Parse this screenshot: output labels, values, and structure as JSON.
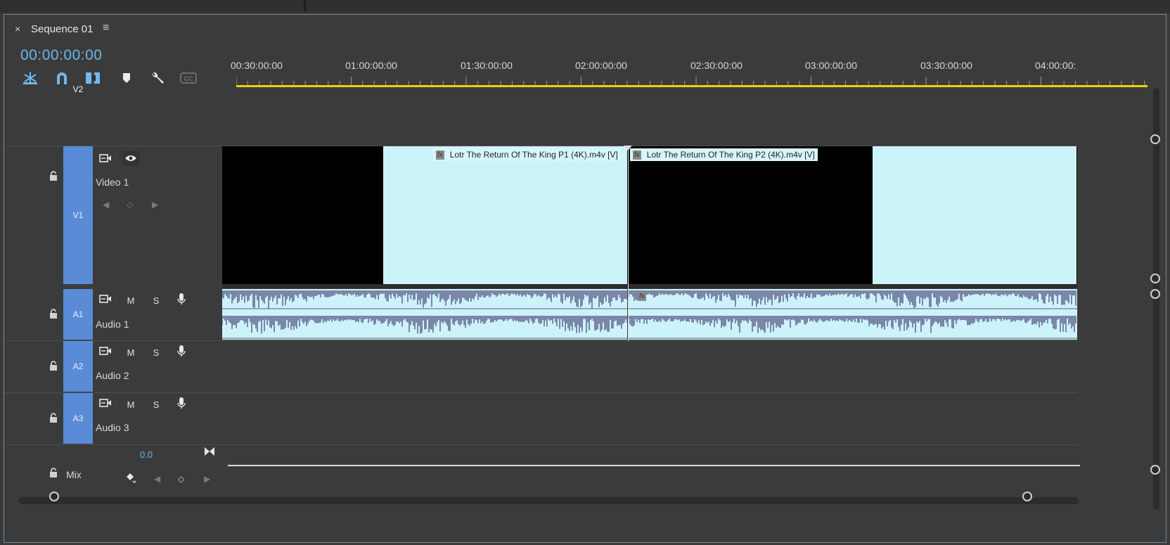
{
  "panel": {
    "title": "Sequence 01",
    "close_glyph": "×",
    "menu_glyph": "≡",
    "timecode": "00:00:00:00"
  },
  "toolbar": [
    {
      "name": "insert-overwrite-icon",
      "glyph": "✲",
      "color": "#6fb7ef"
    },
    {
      "name": "snap-magnet-icon",
      "glyph": "∩",
      "color": "#6fb7ef"
    },
    {
      "name": "linked-selection-icon",
      "glyph": "◧",
      "color": "#6fb7ef"
    },
    {
      "name": "add-marker-icon",
      "glyph": "⬟",
      "color": "#e6e6e6"
    },
    {
      "name": "wrench-settings-icon",
      "glyph": "🔧",
      "color": "#e6e6e6"
    },
    {
      "name": "captions-icon",
      "glyph": "CC",
      "color": "#7a7a7a"
    }
  ],
  "ruler": {
    "labels": [
      "00:30:00:00",
      "01:00:00:00",
      "01:30:00:00",
      "02:00:00:00",
      "02:30:00:00",
      "03:00:00:00",
      "03:30:00:00",
      "04:00:00:"
    ]
  },
  "tracks": {
    "v2": {
      "label": "V2"
    },
    "v1": {
      "label": "V1",
      "name": "Video 1"
    },
    "a1": {
      "label": "A1",
      "name": "Audio 1"
    },
    "a2": {
      "label": "A2",
      "name": "Audio 2"
    },
    "a3": {
      "label": "A3",
      "name": "Audio 3"
    }
  },
  "track_controls": {
    "m": "M",
    "s": "S"
  },
  "mix": {
    "label": "Mix",
    "value": "0.0"
  },
  "clips": {
    "p1": {
      "fx": "fx",
      "label": "Lotr The Return Of The King P1 (4K).m4v [V]"
    },
    "p2": {
      "fx": "fx",
      "label": "Lotr The Return Of The King P2 (4K).m4v [V]"
    },
    "audio_fx": "fx"
  },
  "colors": {
    "accent_blue": "#68b8f2",
    "track_label": "#5a8bd6",
    "clip_fill": "#cdf3fa",
    "waveform": "#7b86a8",
    "work_area": "#e8d300"
  }
}
